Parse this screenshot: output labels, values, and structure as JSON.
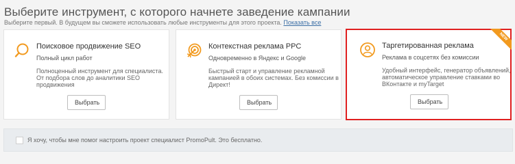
{
  "header": {
    "title": "Выберите инструмент, с которого начнете заведение кампании",
    "subtitle": "Выберите первый. В будущем вы сможете использовать любые инструменты для этого проекта.",
    "show_all_link": "Показать все"
  },
  "cards": [
    {
      "title": "Поисковое продвижение SEO",
      "subtitle": "Полный цикл работ",
      "description": "Полноценный инструмент для специалиста. От подбора слов до аналитики SEO продвижения",
      "button": "Выбрать",
      "icon": "search-icon"
    },
    {
      "title": "Контекстная реклама PPC",
      "subtitle": "Одновременно в Яндекс и Google",
      "description": "Быстрый старт и управление рекламной кампанией в обоих системах. Без комиссии в Директ!",
      "button": "Выбрать",
      "icon": "target-icon"
    },
    {
      "title": "Таргетированная реклама",
      "subtitle": "Реклама в соцсетях без комиссии",
      "description": "Удобный интерфейс, генератор объявлений, автоматическое управление ставками во ВКонтакте и myTarget",
      "button": "Выбрать",
      "icon": "user-icon",
      "badge": "NEW",
      "highlighted": true
    }
  ],
  "help_option": {
    "label": "Я хочу, чтобы мне помог настроить проект специалист PromoPult. Это бесплатно.",
    "checked": false
  },
  "colors": {
    "accent": "#f29a1f",
    "highlight_border": "#e02020",
    "link": "#3a6ea5"
  }
}
